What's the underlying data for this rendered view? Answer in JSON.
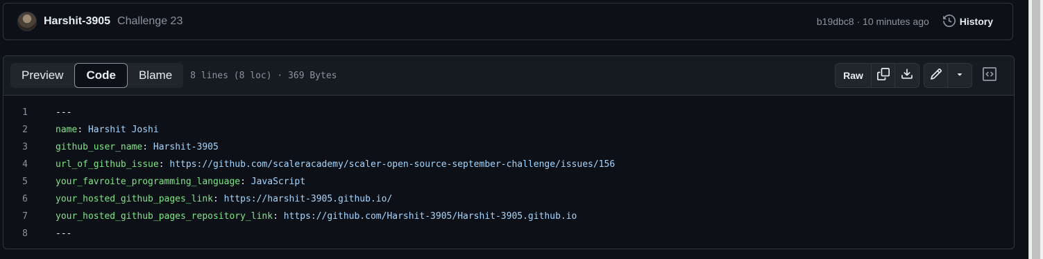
{
  "commit": {
    "author": "Harshit-3905",
    "message": "Challenge 23",
    "meta": "b19dbc8 · 10 minutes ago",
    "history_label": "History"
  },
  "file": {
    "tabs": [
      "Preview",
      "Code",
      "Blame"
    ],
    "active_tab": "Code",
    "info": "8 lines (8 loc) · 369 Bytes",
    "raw_label": "Raw",
    "icons": {
      "copy": "copy-icon",
      "download": "download-icon",
      "edit": "pencil-icon",
      "more": "triangle-down-icon",
      "symbols": "code-square-icon",
      "history": "history-icon"
    }
  },
  "code": {
    "lines": [
      {
        "n": "1",
        "key": "",
        "sep": "",
        "value": "---"
      },
      {
        "n": "2",
        "key": "name",
        "sep": ": ",
        "value": "Harshit Joshi"
      },
      {
        "n": "3",
        "key": "github_user_name",
        "sep": ": ",
        "value": "Harshit-3905"
      },
      {
        "n": "4",
        "key": "url_of_github_issue",
        "sep": ": ",
        "value": "https://github.com/scaleracademy/scaler-open-source-september-challenge/issues/156"
      },
      {
        "n": "5",
        "key": "your_favroite_programming_language",
        "sep": ": ",
        "value": "JavaScript"
      },
      {
        "n": "6",
        "key": "your_hosted_github_pages_link",
        "sep": ": ",
        "value": "https://harshit-3905.github.io/"
      },
      {
        "n": "7",
        "key": "your_hosted_github_pages_repository_link",
        "sep": ": ",
        "value": "https://github.com/Harshit-3905/Harshit-3905.github.io"
      },
      {
        "n": "8",
        "key": "",
        "sep": "",
        "value": "---"
      }
    ]
  },
  "colors": {
    "background": "#0d1117",
    "key": "#7ee787",
    "value": "#a5d6ff",
    "muted": "#8b949e",
    "border": "#30363d"
  }
}
